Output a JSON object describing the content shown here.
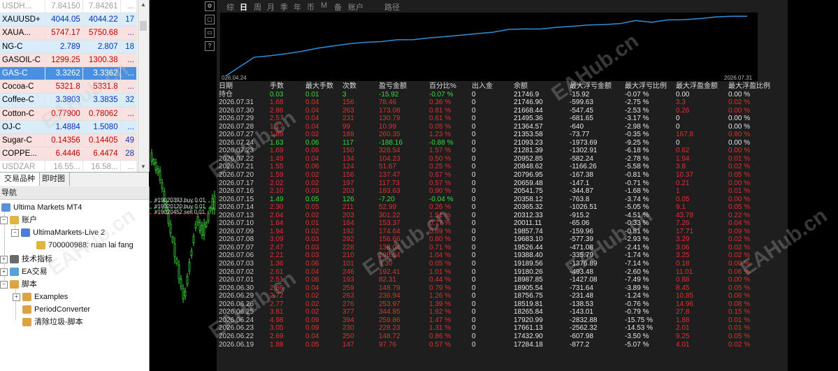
{
  "market_watch": {
    "rows": [
      {
        "symbol": "USDH...",
        "bid": "7.84150",
        "ask": "7.84261",
        "spread": "...",
        "state": "dim"
      },
      {
        "symbol": "XAUUSD+",
        "bid": "4044.05",
        "ask": "4044.22",
        "spread": "17",
        "state": "up"
      },
      {
        "symbol": "XAUA...",
        "bid": "5747.17",
        "ask": "5750.68",
        "spread": "...",
        "state": "dn"
      },
      {
        "symbol": "NG-C",
        "bid": "2.789",
        "ask": "2.807",
        "spread": "18",
        "state": "up"
      },
      {
        "symbol": "GASOIL-C",
        "bid": "1299.25",
        "ask": "1300.38",
        "spread": "...",
        "state": "dn"
      },
      {
        "symbol": "GAS-C",
        "bid": "3.3262",
        "ask": "3.3362",
        "spread": "...",
        "state": "sel"
      },
      {
        "symbol": "Cocoa-C",
        "bid": "5321.8",
        "ask": "5331.8",
        "spread": "...",
        "state": "dn"
      },
      {
        "symbol": "Coffee-C",
        "bid": "3.3803",
        "ask": "3.3835",
        "spread": "32",
        "state": "up"
      },
      {
        "symbol": "Cotton-C",
        "bid": "0.77900",
        "ask": "0.78062",
        "spread": "...",
        "state": "dn"
      },
      {
        "symbol": "OJ-C",
        "bid": "1.4884",
        "ask": "1.5080",
        "spread": "...",
        "state": "up"
      },
      {
        "symbol": "Sugar-C",
        "bid": "0.14356",
        "ask": "0.14405",
        "spread": "49",
        "state": "dn"
      },
      {
        "symbol": "COPPE...",
        "bid": "6.4446",
        "ask": "6.4474",
        "spread": "28",
        "state": "dn"
      },
      {
        "symbol": "USDZAR",
        "bid": "16.55...",
        "ask": "16.58...",
        "spread": "...",
        "state": "dim"
      }
    ]
  },
  "tabs": {
    "trade_symbols": "交易品种",
    "tick_chart": "即时图"
  },
  "navigator": {
    "title": "导航",
    "root": "Ultima Markets MT4",
    "accounts": "账户",
    "server": "UltimaMarkets-Live 2",
    "account": "700000988: ruan lai fang",
    "indicators": "技术指标",
    "ea": "EA交易",
    "scripts": "脚本",
    "examples": "Examples",
    "period_converter": "PeriodConverter",
    "clean_script": "清除垃圾-脚本"
  },
  "chart_labels": {
    "order1": "#19020393 buy 0.01",
    "order2": "#19020120 buy 0.01",
    "order3": "#19020452 sell 0.01"
  },
  "watermark": "EAHub.cn",
  "report": {
    "tabs": [
      "综",
      "日",
      "周",
      "月",
      "季",
      "年",
      "币",
      "M",
      "备",
      "账户",
      "路径"
    ],
    "active_tab": "日",
    "chart_start": "026.04.24",
    "chart_end": "2026.07.31",
    "headers": [
      "日期",
      "手数",
      "最大手数",
      "次数",
      "盈亏金额",
      "百分比%",
      "出入金",
      "余额",
      "最大浮亏金额",
      "最大浮亏比例",
      "最大浮盈金额",
      "最大浮盈比例"
    ],
    "holding": [
      "持仓",
      "0.03",
      "0.01",
      "3",
      "-15.92",
      "-0.07 %",
      "0",
      "21746.9",
      "-15.92",
      "-0.07 %",
      "0.00",
      "0.00 %"
    ],
    "rows": [
      [
        "2026.07.31",
        "1.68",
        "0.04",
        "156",
        "78.46",
        "0.36 %",
        "0",
        "21746.90",
        "-599.63",
        "-2.75 %",
        "3.3",
        "0.02 %"
      ],
      [
        "2026.07.30",
        "2.86",
        "0.04",
        "263",
        "173.08",
        "0.81 %",
        "0",
        "21668.44",
        "-547.45",
        "-2.53 %",
        "0.26",
        "0.00 %"
      ],
      [
        "2026.07.29",
        "2.57",
        "0.04",
        "231",
        "130.79",
        "0.61 %",
        "0",
        "21495.36",
        "-681.65",
        "-3.17 %",
        "0",
        "0.00 %"
      ],
      [
        "2026.07.28",
        "1.17",
        "0.04",
        "99",
        "10.99",
        "0.05 %",
        "0",
        "21364.57",
        "-640",
        "-2.98 %",
        "0",
        "0.00 %"
      ],
      [
        "2026.07.27",
        "1.89",
        "0.02",
        "188",
        "260.35",
        "1.23 %",
        "0",
        "21353.58",
        "-73.77",
        "-0.35 %",
        "167.8",
        "0.80 %"
      ],
      [
        "2026.07.24",
        "1.63",
        "0.06",
        "117",
        "-188.16",
        "-0.88 %",
        "0",
        "21093.23",
        "-1973.69",
        "-9.25 %",
        "0",
        "0.00 %"
      ],
      [
        "2026.07.23",
        "1.69",
        "0.06",
        "150",
        "328.54",
        "1.57 %",
        "0",
        "21281.39",
        "-1302.91",
        "-6.18 %",
        "0.62",
        "0.00 %"
      ],
      [
        "2026.07.22",
        "1.49",
        "0.04",
        "134",
        "104.23",
        "0.50 %",
        "0",
        "20952.85",
        "-582.24",
        "-2.78 %",
        "1.94",
        "0.01 %"
      ],
      [
        "2026.07.21",
        "1.55",
        "0.06",
        "124",
        "51.67",
        "0.25 %",
        "0",
        "20848.62",
        "-1166.26",
        "-5.58 %",
        "3.8",
        "0.02 %"
      ],
      [
        "2026.07.20",
        "1.59",
        "0.02",
        "156",
        "137.47",
        "0.67 %",
        "0",
        "20796.95",
        "-167.38",
        "-0.81 %",
        "10.37",
        "0.05 %"
      ],
      [
        "2026.07.17",
        "2.02",
        "0.02",
        "197",
        "117.73",
        "0.57 %",
        "0",
        "20659.48",
        "-147.1",
        "-0.71 %",
        "0.21",
        "0.00 %"
      ],
      [
        "2026.07.16",
        "2.10",
        "0.03",
        "203",
        "183.63",
        "0.90 %",
        "0",
        "20541.75",
        "-344.87",
        "-1.68 %",
        "1",
        "0.01 %"
      ],
      [
        "2026.07.15",
        "1.49",
        "0.05",
        "126",
        "-7.20",
        "-0.04 %",
        "0",
        "20358.12",
        "-763.8",
        "-3.74 %",
        "0.05",
        "0.00 %"
      ],
      [
        "2026.07.14",
        "2.30",
        "0.05",
        "211",
        "52.99",
        "0.26 %",
        "0",
        "20365.32",
        "-1026.51",
        "-5.05 %",
        "9.1",
        "0.05 %"
      ],
      [
        "2026.07.13",
        "2.04",
        "0.02",
        "203",
        "301.22",
        "1.51 %",
        "0",
        "20312.33",
        "-915.2",
        "-4.51 %",
        "43.78",
        "0.22 %"
      ],
      [
        "2026.07.10",
        "1.64",
        "0.01",
        "164",
        "153.37",
        "0.77 %",
        "0",
        "20011.11",
        "-65.06",
        "-0.33 %",
        "7.26",
        "0.04 %"
      ],
      [
        "2026.07.09",
        "1.94",
        "0.02",
        "192",
        "174.64",
        "0.89 %",
        "0",
        "19857.74",
        "-159.96",
        "-0.81 %",
        "17.71",
        "0.09 %"
      ],
      [
        "2026.07.08",
        "3.09",
        "0.03",
        "292",
        "156.66",
        "0.80 %",
        "0",
        "19683.10",
        "-577.39",
        "-2.93 %",
        "3.29",
        "0.02 %"
      ],
      [
        "2026.07.07",
        "2.47",
        "0.03",
        "228",
        "138.04",
        "0.71 %",
        "0",
        "19526.44",
        "-471.08",
        "-2.41 %",
        "3.06",
        "0.02 %"
      ],
      [
        "2026.07.06",
        "2.21",
        "0.03",
        "210",
        "198.84",
        "1.04 %",
        "0",
        "19388.40",
        "-335.79",
        "-1.74 %",
        "3.25",
        "0.02 %"
      ],
      [
        "2026.07.03",
        "1.36",
        "0.06",
        "101",
        "9.30",
        "0.05 %",
        "0",
        "19189.56",
        "-1376.89",
        "-7.14 %",
        "0.18",
        "0.00 %"
      ],
      [
        "2026.07.02",
        "2.61",
        "0.04",
        "246",
        "192.41",
        "1.01 %",
        "0",
        "19180.26",
        "-493.48",
        "-2.60 %",
        "11.01",
        "0.06 %"
      ],
      [
        "2026.07.01",
        "2.51",
        "0.06",
        "193",
        "82.31",
        "0.44 %",
        "0",
        "18987.85",
        "-1427.08",
        "-7.49 %",
        "0.88",
        "0.00 %"
      ],
      [
        "2026.06.30",
        "2.86",
        "0.04",
        "259",
        "148.79",
        "0.79 %",
        "0",
        "18905.54",
        "-731.64",
        "-3.89 %",
        "8.45",
        "0.05 %"
      ],
      [
        "2026.06.29",
        "2.72",
        "0.02",
        "263",
        "236.94",
        "1.26 %",
        "0",
        "18756.75",
        "-231.48",
        "-1.24 %",
        "10.85",
        "0.06 %"
      ],
      [
        "2026.06.26",
        "2.77",
        "0.02",
        "276",
        "253.97",
        "1.39 %",
        "0",
        "18519.81",
        "-138.53",
        "-0.76 %",
        "14.96",
        "0.08 %"
      ],
      [
        "2026.06.25",
        "3.81",
        "0.02",
        "377",
        "344.85",
        "1.92 %",
        "0",
        "18265.84",
        "-143.01",
        "-0.79 %",
        "27.8",
        "0.15 %"
      ],
      [
        "2026.06.24",
        "4.98",
        "0.09",
        "394",
        "259.86",
        "1.47 %",
        "0",
        "17920.99",
        "-2832.88",
        "-15.75 %",
        "1.88",
        "0.01 %"
      ],
      [
        "2026.06.23",
        "3.05",
        "0.09",
        "230",
        "228.23",
        "1.31 %",
        "0",
        "17661.13",
        "-2562.32",
        "-14.53 %",
        "2.01",
        "0.01 %"
      ],
      [
        "2026.06.22",
        "2.69",
        "0.04",
        "250",
        "148.72",
        "0.86 %",
        "0",
        "17432.90",
        "-607.98",
        "-3.50 %",
        "9.25",
        "0.05 %"
      ],
      [
        "2026.06.19",
        "1.88",
        "0.05",
        "147",
        "97.76",
        "0.57 %",
        "0",
        "17284.18",
        "-877.2",
        "-5.07 %",
        "4.01",
        "0.02 %"
      ]
    ]
  },
  "colors": {
    "profit": "#e03030",
    "loss": "#3cd83c",
    "equity_line": "#2f8fd8",
    "candle": "#3cd83c"
  }
}
